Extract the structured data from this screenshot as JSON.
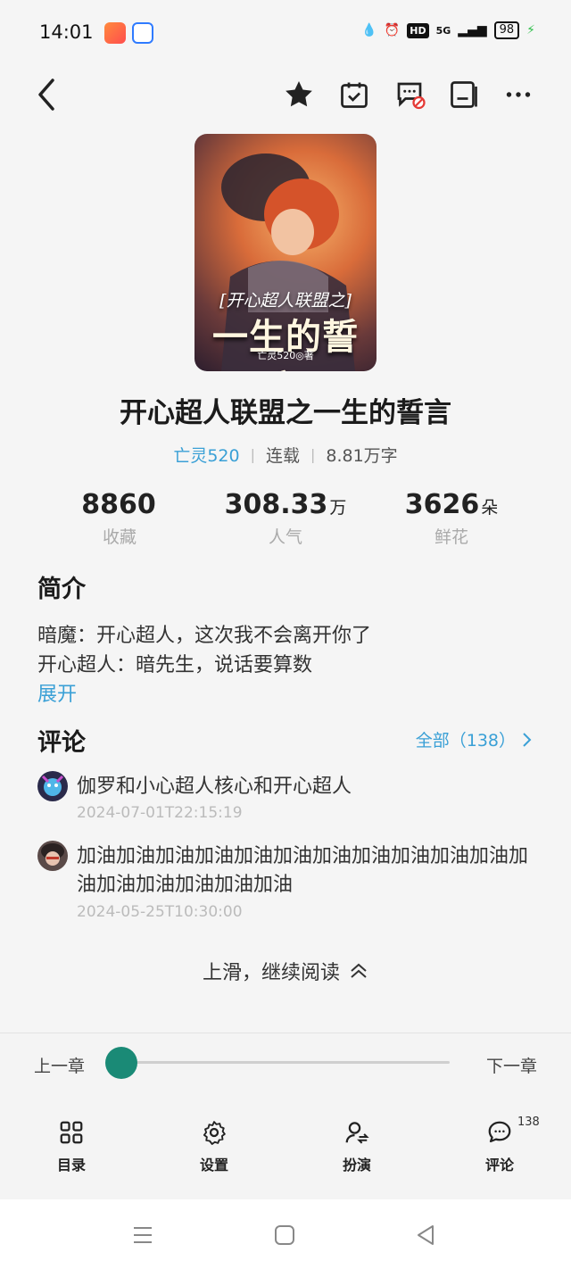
{
  "status_bar": {
    "time": "14:01",
    "hd": "HD",
    "network": "5G",
    "battery": "98"
  },
  "toolbar": {
    "icons": [
      "back-arrow-icon",
      "star-icon",
      "calendar-check-icon",
      "comment-blocked-icon",
      "bookshelf-icon",
      "more-icon"
    ]
  },
  "cover": {
    "title_top": "[开心超人联盟之]",
    "title_main": "一生的誓言",
    "author": "亡灵520◎著"
  },
  "book": {
    "title": "开心超人联盟之一生的誓言",
    "author": "亡灵520",
    "status": "连载",
    "word_count": "8.81万字"
  },
  "stats": [
    {
      "value": "8860",
      "unit": "",
      "label": "收藏"
    },
    {
      "value": "308.33",
      "unit": "万",
      "label": "人气"
    },
    {
      "value": "3626",
      "unit": "朵",
      "label": "鲜花"
    }
  ],
  "intro": {
    "heading": "简介",
    "lines": [
      "暗魔：开心超人，这次我不会离开你了",
      "开心超人：暗先生，说话要算数"
    ],
    "expand": "展开"
  },
  "comments": {
    "heading": "评论",
    "all_link": "全部（138）",
    "items": [
      {
        "text": "伽罗和小心超人核心和开心超人",
        "time": "2024-07-01T22:15:19"
      },
      {
        "text": "加油加油加油加油加油加油加油加油加油加油加油加油加油加油加油加油加油",
        "time": "2024-05-25T10:30:00"
      }
    ]
  },
  "continue_reading": "上滑，继续阅读",
  "chapter_nav": {
    "prev": "上一章",
    "next": "下一章",
    "progress": 0
  },
  "bottom_nav": {
    "items": [
      {
        "label": "目录",
        "icon": "grid-icon"
      },
      {
        "label": "设置",
        "icon": "gear-icon"
      },
      {
        "label": "扮演",
        "icon": "user-switch-icon"
      },
      {
        "label": "评论",
        "icon": "comment-icon"
      }
    ],
    "comment_badge": "138"
  },
  "colors": {
    "accent": "#3aa0d6",
    "slider": "#1a8a76"
  }
}
